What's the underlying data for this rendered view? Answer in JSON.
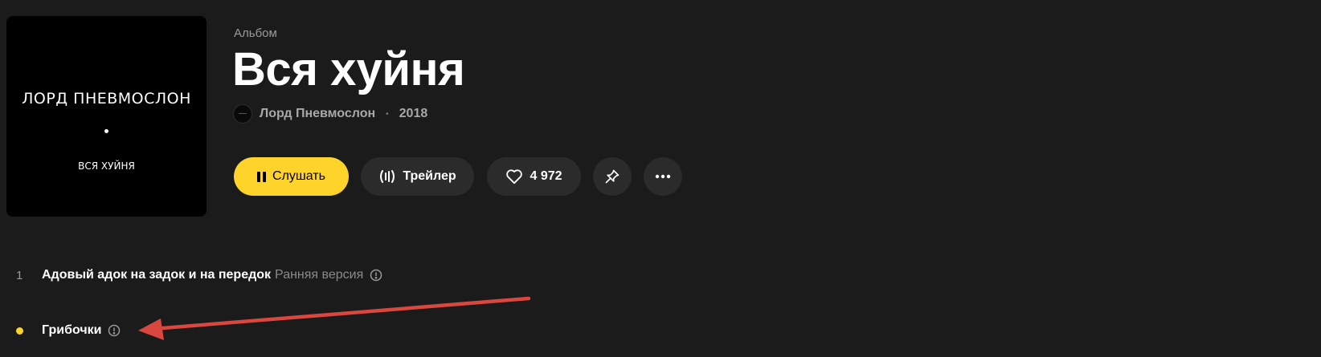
{
  "cover": {
    "artist_text": "ЛОРД ПНЕВМОСЛОН",
    "title_text": "ВСЯ ХУЙНЯ"
  },
  "album": {
    "type_label": "Альбом",
    "title": "Вся хуйня",
    "artist": "Лорд Пневмослон",
    "separator": "•",
    "year": "2018"
  },
  "actions": {
    "listen_label": "Слушать",
    "trailer_label": "Трейлер",
    "likes_count": "4 972"
  },
  "tracks": [
    {
      "number": "1",
      "title": "Адовый адок на задок и на передок",
      "version": "Ранняя версия",
      "playing": false
    },
    {
      "number": "",
      "title": "Грибочки",
      "version": "",
      "playing": true
    }
  ],
  "colors": {
    "background": "#1b1b1b",
    "accent": "#fed42b",
    "button": "#2b2b2b",
    "muted_text": "#9a9a9a",
    "annotation_arrow": "#d9473f"
  },
  "icons": {
    "listen_button": "pause-icon",
    "trailer_button": "waveform-icon",
    "like_button": "heart-icon",
    "pin_button": "pin-icon",
    "more_button": "more-dots-icon",
    "track_info": "info-circle-icon",
    "annotation": "red-arrow-icon"
  }
}
